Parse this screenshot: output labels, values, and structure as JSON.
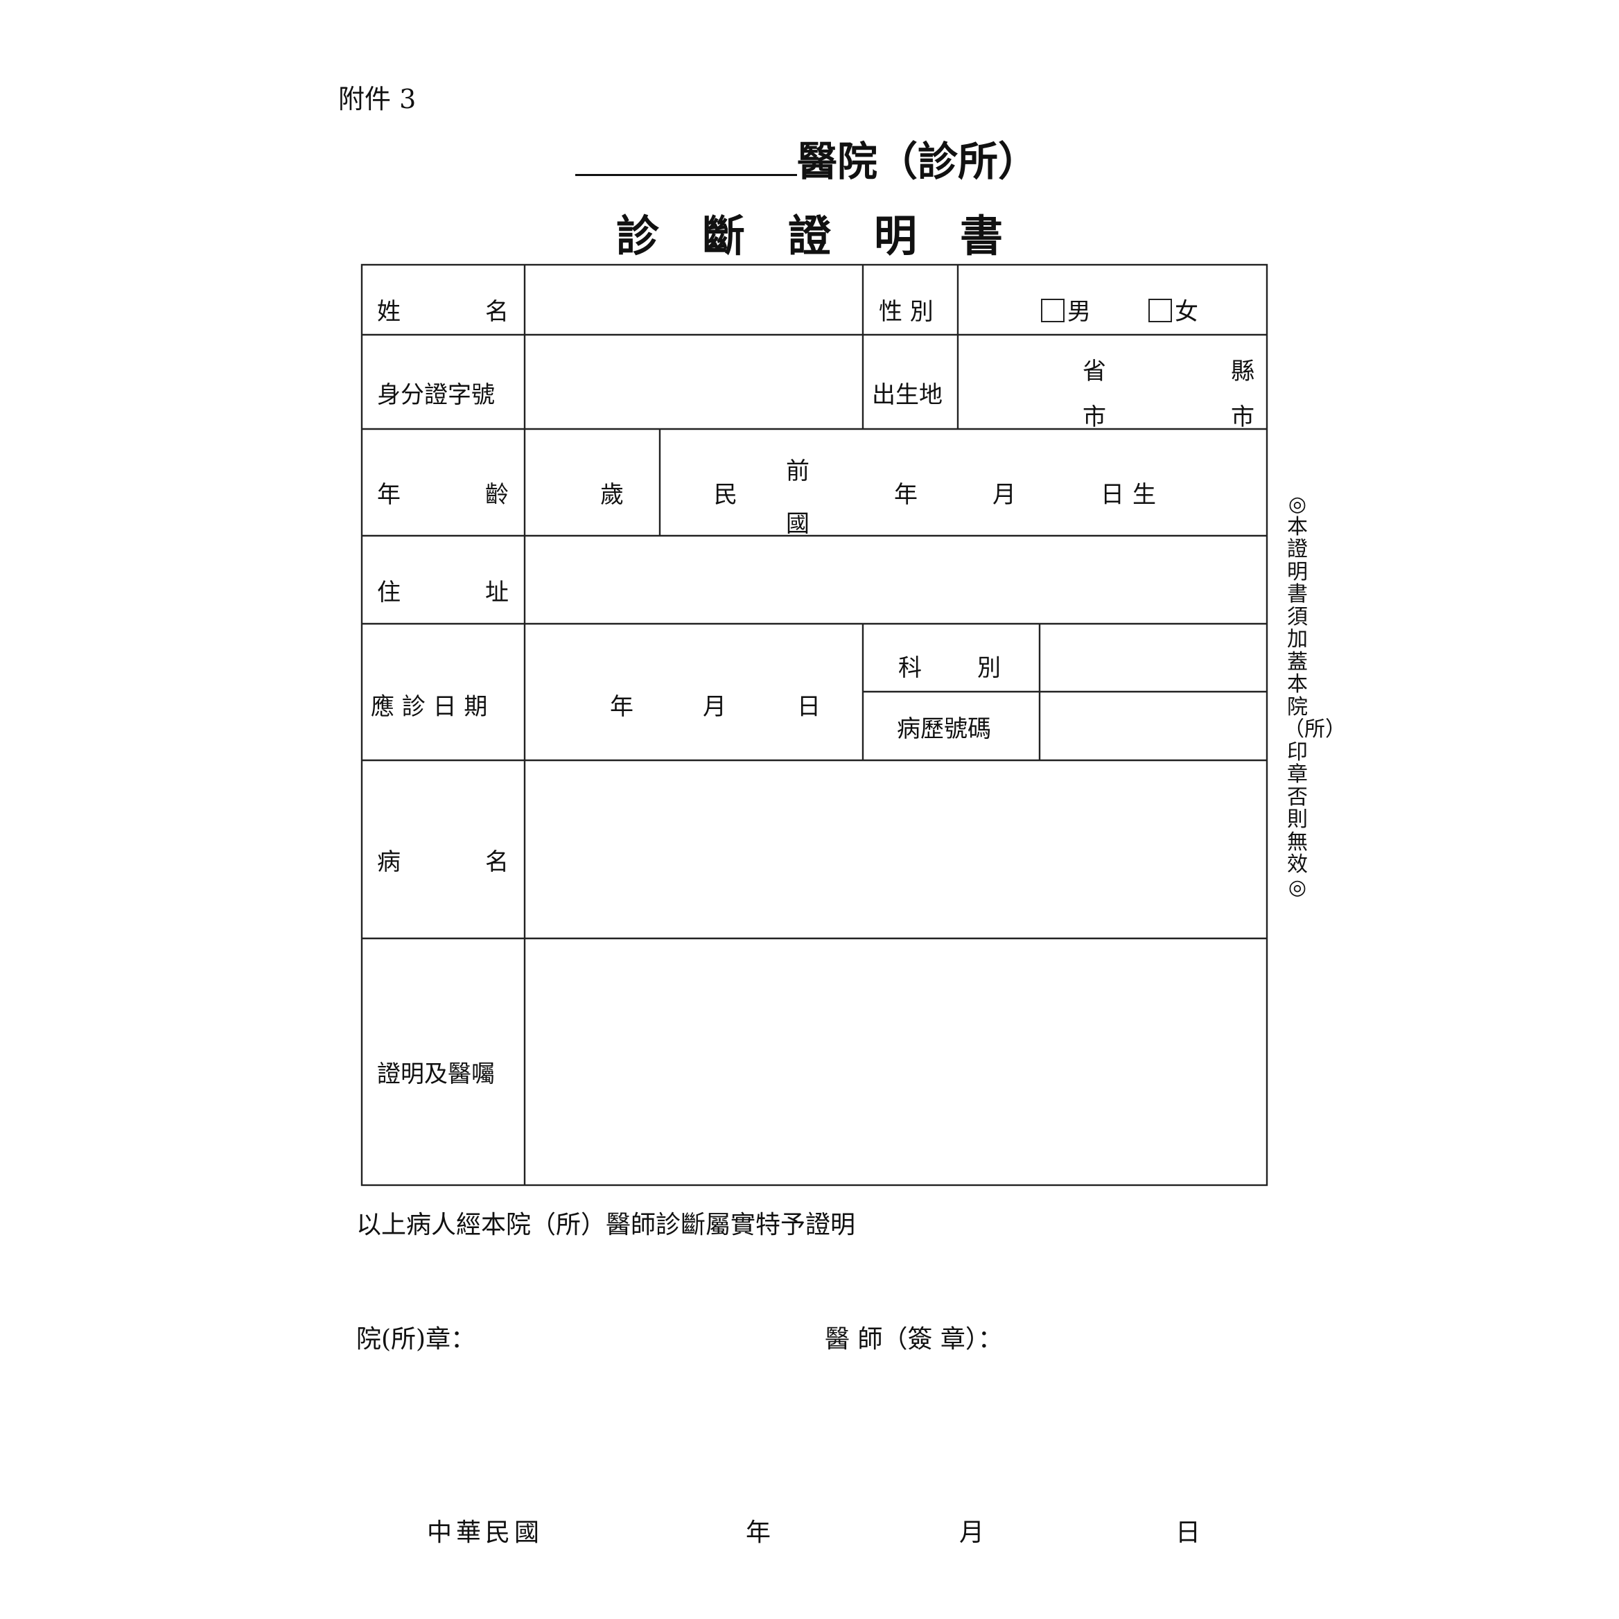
{
  "attachment_label": "附件 3",
  "hospital_title": "醫院（診所）",
  "doc_title": "診斷證明書",
  "form": {
    "name_label_a": "姓",
    "name_label_b": "名",
    "gender_label": "性 別",
    "male": "男",
    "female": "女",
    "id_label": "身分證字號",
    "birthplace_label": "出生地",
    "province": "省",
    "county": "縣",
    "city_a": "市",
    "city_b": "市",
    "age_label_a": "年",
    "age_label_b": "齡",
    "age_unit": "歲",
    "era_min": "民",
    "era_qian": "前",
    "era_guo": "國",
    "birth_year": "年",
    "birth_month": "月",
    "birth_day": "日",
    "birth_born": "生",
    "address_label_a": "住",
    "address_label_b": "址",
    "visit_label": "應 診 日 期",
    "visit_year": "年",
    "visit_month": "月",
    "visit_day": "日",
    "dept_label_a": "科",
    "dept_label_b": "別",
    "record_label": "病歷號碼",
    "disease_label_a": "病",
    "disease_label_b": "名",
    "advice_label": "證明及醫囑"
  },
  "stamp_note": "◎本證明書須加蓋本院（所）印章否則無效◎",
  "certify_text": "以上病人經本院（所）醫師診斷屬實特予證明",
  "hospital_seal_label": "院(所)章：",
  "doctor_sign_label": "醫 師（簽 章）：",
  "date_line": {
    "era": "中華民國",
    "year": "年",
    "month": "月",
    "day": "日"
  }
}
